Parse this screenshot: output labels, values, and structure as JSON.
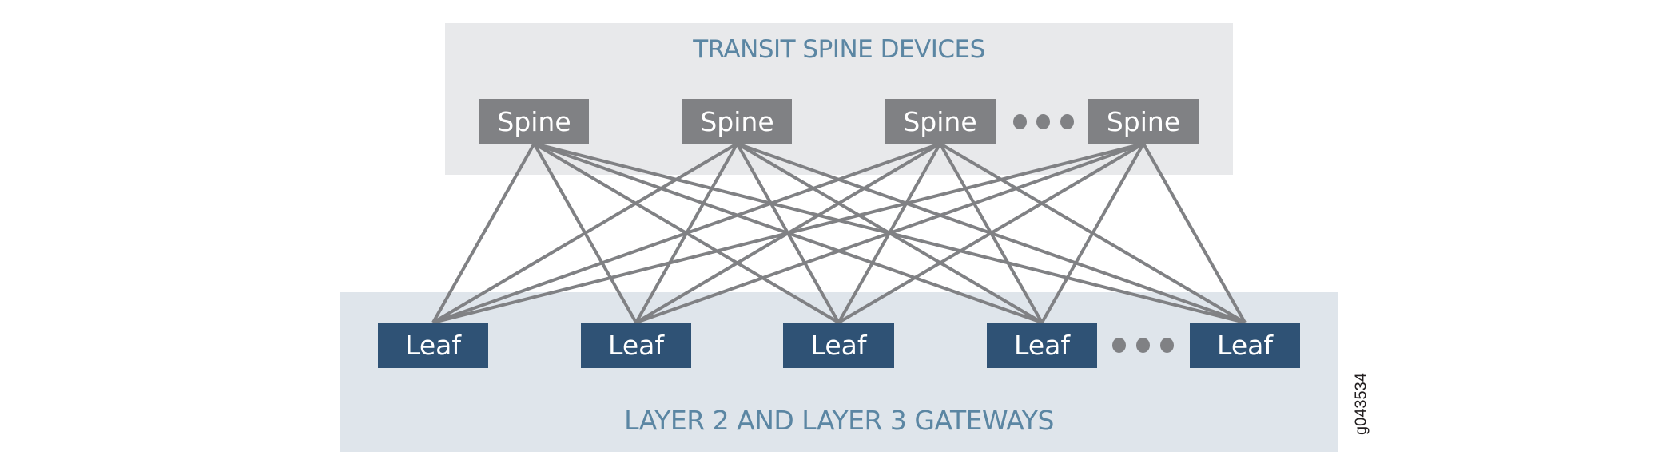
{
  "diagram": {
    "spine_panel": {
      "title": "TRANSIT SPINE DEVICES",
      "fill": "#e8e9eb",
      "title_color": "#5b86a3"
    },
    "leaf_panel": {
      "title": "LAYER 2 AND LAYER 3 GATEWAYS",
      "fill": "#dfe5eb",
      "title_color": "#5b86a3"
    },
    "spines": [
      {
        "id": "spine-1",
        "label": "Spine"
      },
      {
        "id": "spine-2",
        "label": "Spine"
      },
      {
        "id": "spine-3",
        "label": "Spine"
      },
      {
        "id": "spine-4",
        "label": "Spine"
      }
    ],
    "leaves": [
      {
        "id": "leaf-1",
        "label": "Leaf"
      },
      {
        "id": "leaf-2",
        "label": "Leaf"
      },
      {
        "id": "leaf-3",
        "label": "Leaf"
      },
      {
        "id": "leaf-4",
        "label": "Leaf"
      },
      {
        "id": "leaf-5",
        "label": "Leaf"
      }
    ],
    "ellipsis": {
      "spines_after_index": 2,
      "leaves_after_index": 3,
      "glyph": "ellipsis-dots"
    },
    "links": "full-mesh spine-to-leaf",
    "colors": {
      "spine": "#808184",
      "leaf": "#2f5275",
      "link": "#808184",
      "node_text": "#ffffff"
    },
    "figure_id": "g043534"
  }
}
